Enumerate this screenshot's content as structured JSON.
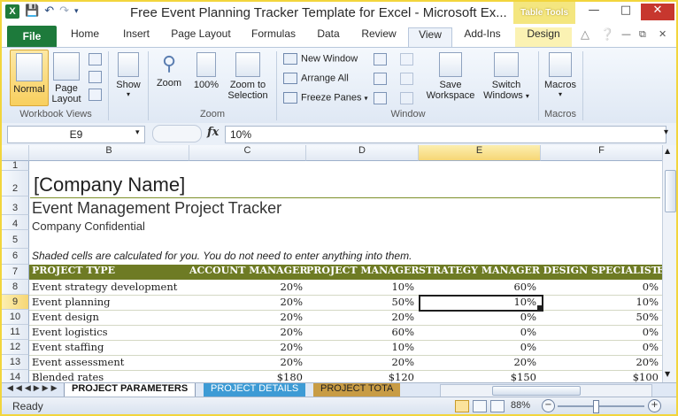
{
  "window": {
    "title": "Free Event Planning Tracker Template for Excel - Microsoft Ex...",
    "context_tools": "Table Tools",
    "minimize": "—",
    "maximize": "□",
    "close": "✕"
  },
  "quick_access": {
    "save_icon": "save-icon",
    "undo_icon": "undo-icon",
    "redo_icon": "redo-icon",
    "customize_icon": "dropdown-icon"
  },
  "tabs": [
    "File",
    "Home",
    "Insert",
    "Page Layout",
    "Formulas",
    "Data",
    "Review",
    "View",
    "Add-Ins",
    "Design"
  ],
  "active_tab": "View",
  "ribbon": {
    "workbook_views": {
      "label": "Workbook Views",
      "normal": "Normal",
      "page_layout_1": "Page",
      "page_layout_2": "Layout"
    },
    "show": {
      "label": "Show"
    },
    "zoom": {
      "label": "Zoom",
      "zoom": "Zoom",
      "hundred": "100%",
      "zoom_sel_1": "Zoom to",
      "zoom_sel_2": "Selection"
    },
    "window": {
      "label": "Window",
      "new_window": "New Window",
      "arrange_all": "Arrange All",
      "freeze_panes": "Freeze Panes",
      "save_workspace_1": "Save",
      "save_workspace_2": "Workspace",
      "switch_windows_1": "Switch",
      "switch_windows_2": "Windows"
    },
    "macros": {
      "label": "Macros",
      "macros": "Macros"
    }
  },
  "formula_bar": {
    "name_box": "E9",
    "fx": "fx",
    "value": "10%"
  },
  "columns": [
    "B",
    "C",
    "D",
    "E",
    "F"
  ],
  "selected_column": "E",
  "rows": [
    "1",
    "2",
    "3",
    "4",
    "5",
    "6",
    "7",
    "8",
    "9",
    "10",
    "11",
    "12",
    "13",
    "14"
  ],
  "selected_row": "9",
  "sheet": {
    "company": "[Company Name]",
    "tracker_title": "Event Management Project Tracker",
    "confidential": "Company Confidential",
    "note": "Shaded cells are calculated for you. You do not need to enter anything into them.",
    "headers": [
      "PROJECT TYPE",
      "ACCOUNT MANAGER",
      "PROJECT MANAGER",
      "STRATEGY MANAGER",
      "DESIGN SPECIALIST",
      "E"
    ],
    "table": [
      {
        "type": "Event strategy development",
        "values": [
          "20%",
          "10%",
          "60%",
          "0%"
        ]
      },
      {
        "type": "Event planning",
        "values": [
          "20%",
          "50%",
          "10%",
          "10%"
        ]
      },
      {
        "type": "Event design",
        "values": [
          "20%",
          "20%",
          "0%",
          "50%"
        ]
      },
      {
        "type": "Event logistics",
        "values": [
          "20%",
          "60%",
          "0%",
          "0%"
        ]
      },
      {
        "type": "Event staffing",
        "values": [
          "20%",
          "10%",
          "0%",
          "0%"
        ]
      },
      {
        "type": "Event assessment",
        "values": [
          "20%",
          "20%",
          "20%",
          "20%"
        ]
      },
      {
        "type": "Blended rates",
        "values": [
          "$180",
          "$120",
          "$150",
          "$100"
        ]
      }
    ]
  },
  "sheet_tabs": [
    "PROJECT PARAMETERS",
    "PROJECT DETAILS",
    "PROJECT TOTA"
  ],
  "status": {
    "ready": "Ready",
    "zoom": "88%",
    "zoom_out": "−",
    "zoom_in": "+"
  }
}
